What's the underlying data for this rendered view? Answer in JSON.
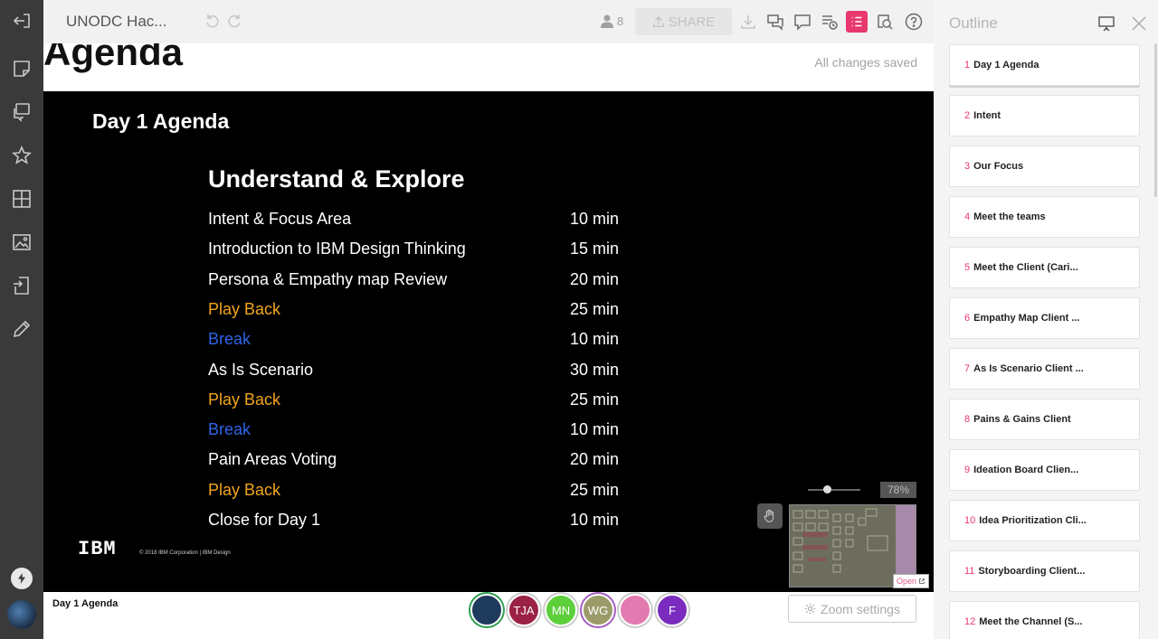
{
  "topbar": {
    "board_title": "UNODC Hac...",
    "user_count": "8",
    "share_label": "SHARE"
  },
  "canvas": {
    "frame_heading": "Agenda",
    "saved_status": "All changes saved"
  },
  "slide": {
    "title": "Day 1 Agenda",
    "section_title": "Understand & Explore",
    "rows": [
      {
        "activity": "Intent & Focus Area",
        "duration": "10 min",
        "color": "#ffffff"
      },
      {
        "activity": "Introduction to IBM Design Thinking",
        "duration": "15 min",
        "color": "#ffffff"
      },
      {
        "activity": "Persona & Empathy map Review",
        "duration": "20 min",
        "color": "#ffffff"
      },
      {
        "activity": "Play Back",
        "duration": "25 min",
        "color": "#f2a51d"
      },
      {
        "activity": "Break",
        "duration": "10 min",
        "color": "#2f64e8"
      },
      {
        "activity": "As Is Scenario",
        "duration": "30 min",
        "color": "#ffffff"
      },
      {
        "activity": "Play Back",
        "duration": "25 min",
        "color": "#f2a51d"
      },
      {
        "activity": "Break",
        "duration": "10 min",
        "color": "#2f64e8"
      },
      {
        "activity": "Pain Areas Voting",
        "duration": "20 min",
        "color": "#ffffff"
      },
      {
        "activity": "Play Back",
        "duration": "25 min",
        "color": "#f2a51d"
      },
      {
        "activity": "Close for Day 1",
        "duration": "10 min",
        "color": "#ffffff"
      }
    ],
    "logo": "IBM",
    "copyright": "© 2018 IBM Corporation  |  IBM Design"
  },
  "minimap": {
    "zoom_percent": "78%",
    "open_label": "Open"
  },
  "bottombar": {
    "current_frame": "Day 1 Agenda",
    "collaborators": [
      {
        "initials": "",
        "color": "#1e3a5c",
        "ring": "#2e9e4e"
      },
      {
        "initials": "TJA",
        "color": "#9b2145",
        "ring": "#cccccc"
      },
      {
        "initials": "MN",
        "color": "#5ccf3a",
        "ring": "#cccccc"
      },
      {
        "initials": "WG",
        "color": "#9b9b6a",
        "ring": "#a35dbf"
      },
      {
        "initials": "",
        "color": "#e27ab0",
        "ring": "#cccccc"
      },
      {
        "initials": "F",
        "color": "#7b2cbf",
        "ring": "#cccccc"
      }
    ],
    "zoom_settings_label": "Zoom settings"
  },
  "outline": {
    "title": "Outline",
    "items": [
      {
        "num": "1",
        "label": "Day 1 Agenda"
      },
      {
        "num": "2",
        "label": "Intent"
      },
      {
        "num": "3",
        "label": "Our Focus"
      },
      {
        "num": "4",
        "label": "Meet the teams"
      },
      {
        "num": "5",
        "label": "Meet the Client (Cari..."
      },
      {
        "num": "6",
        "label": "Empathy Map Client ..."
      },
      {
        "num": "7",
        "label": "As Is Scenario Client ..."
      },
      {
        "num": "8",
        "label": "Pains & Gains Client"
      },
      {
        "num": "9",
        "label": "Ideation Board Clien..."
      },
      {
        "num": "10",
        "label": "Idea Prioritization Cli..."
      },
      {
        "num": "11",
        "label": "Storyboarding Client..."
      },
      {
        "num": "12",
        "label": "Meet the Channel (S..."
      }
    ]
  }
}
